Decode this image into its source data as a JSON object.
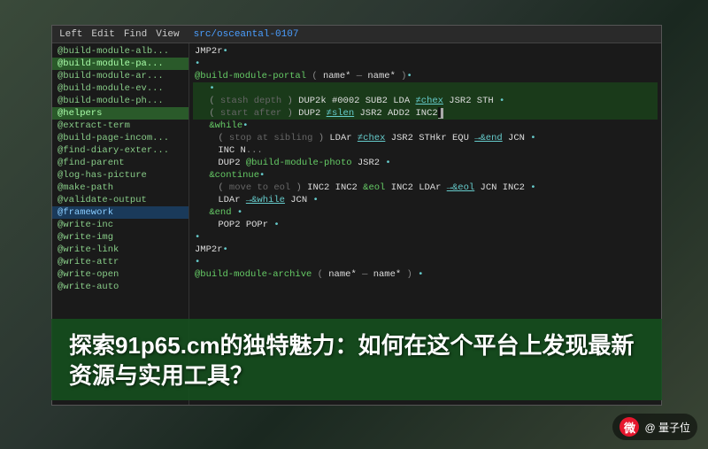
{
  "background": {
    "gradient": "forest background"
  },
  "titlebar": {
    "menus": [
      "Left",
      "Edit",
      "Find",
      "View"
    ],
    "path": "src/osceantal-0107"
  },
  "file_list": [
    {
      "label": "@build-module-alb...",
      "state": "normal"
    },
    {
      "label": "@build-module-pa...",
      "state": "highlighted"
    },
    {
      "label": "@build-module-ar...",
      "state": "normal"
    },
    {
      "label": "@build-module-ev...",
      "state": "normal"
    },
    {
      "label": "@build-module-ph...",
      "state": "normal"
    },
    {
      "label": "@helpers",
      "state": "highlighted"
    },
    {
      "label": "@extract-term",
      "state": "normal"
    },
    {
      "label": "@build-page-incom...",
      "state": "normal"
    },
    {
      "label": "@find-diary-exter...",
      "state": "normal"
    },
    {
      "label": "@find-parent",
      "state": "normal"
    },
    {
      "label": "@log-has-picture",
      "state": "normal"
    },
    {
      "label": "@make-path",
      "state": "normal"
    },
    {
      "label": "@validate-output",
      "state": "normal"
    },
    {
      "label": "@framework",
      "state": "highlighted-blue"
    },
    {
      "label": "@write-inc",
      "state": "normal"
    },
    {
      "label": "@write-img",
      "state": "normal"
    },
    {
      "label": "@write-link",
      "state": "normal"
    },
    {
      "label": "@write-attr",
      "state": "normal"
    },
    {
      "label": "@write-open",
      "state": "normal"
    },
    {
      "label": "@write-auto",
      "state": "normal"
    }
  ],
  "code_lines": [
    {
      "indent": 0,
      "content": "JMP2r•"
    },
    {
      "indent": 0,
      "content": "•"
    },
    {
      "indent": 0,
      "content": "@build-module-portal ( name* — name* )•"
    },
    {
      "indent": 1,
      "content": "•"
    },
    {
      "indent": 1,
      "content": "( stash depth ) DUP2k #0002 SUB2 LDA ≠chex JSR2 STH•"
    },
    {
      "indent": 1,
      "content": "( start after ) DUP2 ≠slen JSR2 ADD2 INC2•"
    },
    {
      "indent": 1,
      "content": "&while•"
    },
    {
      "indent": 2,
      "content": "( stop at sibling ) LDAr ≠chex JSR2 STHkr EQU →&end JCN•"
    },
    {
      "indent": 2,
      "content": "INC N..."
    },
    {
      "indent": 2,
      "content": "DUP2 @build-module-photo JSR2•"
    },
    {
      "indent": 1,
      "content": "&continue•"
    },
    {
      "indent": 2,
      "content": "( move to eol ) INC2 INC2 &eol INC2 LDAr →&eol JCN INC2•"
    },
    {
      "indent": 2,
      "content": "LDAr →&while JCN•"
    },
    {
      "indent": 1,
      "content": "&end•"
    },
    {
      "indent": 2,
      "content": "POP2 POPr•"
    },
    {
      "indent": 0,
      "content": "•"
    },
    {
      "indent": 0,
      "content": "JMP2r•"
    },
    {
      "indent": 0,
      "content": "•"
    },
    {
      "indent": 0,
      "content": "@build-module-archive ( name* — name* )•"
    }
  ],
  "overlay": {
    "title": "探索91p65.cm的独特魅力：如何在这个平台上发现最新资源与实用工具？"
  },
  "weibo": {
    "icon": "微",
    "handle": "@ 量子位"
  }
}
